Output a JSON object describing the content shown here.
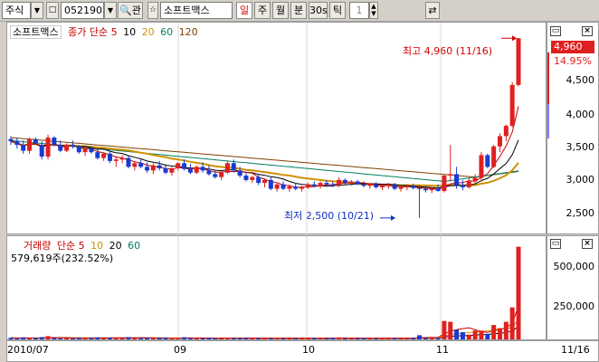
{
  "toolbar": {
    "market": "주식",
    "code": "052190",
    "search_label": "관",
    "name": "소프트맥스",
    "periods": [
      "일",
      "주",
      "월",
      "분",
      "30s",
      "틱"
    ],
    "active_period": "일",
    "interval": "1"
  },
  "price_panel": {
    "legend_name": "소프트맥스",
    "legend_items": [
      {
        "label": "종가 단순 5",
        "color": "#c00000"
      },
      {
        "label": "10",
        "color": "#000000"
      },
      {
        "label": "20",
        "color": "#d09000"
      },
      {
        "label": "60",
        "color": "#008060"
      },
      {
        "label": "120",
        "color": "#804000"
      }
    ],
    "high_note": "최고 4,960 (11/16)",
    "low_note": "최저 2,500 (10/21)",
    "last_price": "4,960",
    "change_pct": "14.95%",
    "y_ticks": [
      "4,500",
      "4,000",
      "3,500",
      "3,000",
      "2,500"
    ]
  },
  "volume_panel": {
    "legend_items": [
      {
        "label": "거래량",
        "color": "#c00000"
      },
      {
        "label": "단순 5",
        "color": "#c00000"
      },
      {
        "label": "10",
        "color": "#d09000"
      },
      {
        "label": "20",
        "color": "#000000"
      },
      {
        "label": "60",
        "color": "#008060"
      }
    ],
    "volume_text": "579,619주(232.52%)",
    "y_ticks": [
      "500,000",
      "250,000"
    ]
  },
  "x_axis": {
    "labels": [
      "2010/07",
      "09",
      "10",
      "11",
      "11/16"
    ]
  },
  "colors": {
    "up": "#e02020",
    "down": "#1a3ad0",
    "background": "#ffffff",
    "frame": "#d4d0c8"
  },
  "chart_data": {
    "type": "candlestick",
    "period_from": "2010/07",
    "period_to": "11/16",
    "candles": [
      [
        3580,
        3620,
        3500,
        3550
      ],
      [
        3550,
        3600,
        3450,
        3500
      ],
      [
        3500,
        3560,
        3380,
        3420
      ],
      [
        3420,
        3600,
        3380,
        3580
      ],
      [
        3580,
        3600,
        3500,
        3520
      ],
      [
        3500,
        3550,
        3300,
        3340
      ],
      [
        3340,
        3640,
        3300,
        3600
      ],
      [
        3600,
        3620,
        3480,
        3500
      ],
      [
        3500,
        3560,
        3400,
        3420
      ],
      [
        3420,
        3520,
        3400,
        3500
      ],
      [
        3500,
        3560,
        3450,
        3480
      ],
      [
        3480,
        3500,
        3380,
        3400
      ],
      [
        3400,
        3480,
        3350,
        3450
      ],
      [
        3450,
        3480,
        3380,
        3400
      ],
      [
        3400,
        3450,
        3300,
        3320
      ],
      [
        3320,
        3400,
        3280,
        3380
      ],
      [
        3380,
        3420,
        3250,
        3280
      ],
      [
        3280,
        3340,
        3200,
        3300
      ],
      [
        3300,
        3360,
        3250,
        3320
      ],
      [
        3320,
        3350,
        3180,
        3200
      ],
      [
        3200,
        3280,
        3150,
        3250
      ],
      [
        3250,
        3300,
        3180,
        3200
      ],
      [
        3200,
        3260,
        3120,
        3150
      ],
      [
        3150,
        3250,
        3100,
        3220
      ],
      [
        3220,
        3280,
        3150,
        3180
      ],
      [
        3180,
        3240,
        3100,
        3120
      ],
      [
        3120,
        3200,
        3080,
        3180
      ],
      [
        3180,
        3260,
        3150,
        3250
      ],
      [
        3250,
        3300,
        3150,
        3170
      ],
      [
        3170,
        3240,
        3100,
        3120
      ],
      [
        3120,
        3220,
        3100,
        3200
      ],
      [
        3200,
        3260,
        3120,
        3150
      ],
      [
        3150,
        3220,
        3080,
        3100
      ],
      [
        3100,
        3160,
        3040,
        3060
      ],
      [
        3060,
        3140,
        3020,
        3120
      ],
      [
        3120,
        3280,
        3100,
        3250
      ],
      [
        3250,
        3300,
        3120,
        3150
      ],
      [
        3150,
        3200,
        3050,
        3080
      ],
      [
        3080,
        3130,
        3000,
        3020
      ],
      [
        3020,
        3080,
        2980,
        3060
      ],
      [
        3060,
        3100,
        2950,
        2980
      ],
      [
        2980,
        3040,
        2920,
        3020
      ],
      [
        3020,
        3060,
        2880,
        2900
      ],
      [
        2900,
        2980,
        2860,
        2960
      ],
      [
        2960,
        3000,
        2880,
        2900
      ],
      [
        2900,
        2960,
        2860,
        2930
      ],
      [
        2930,
        2980,
        2880,
        2900
      ],
      [
        2900,
        2940,
        2860,
        2920
      ],
      [
        2920,
        2980,
        2900,
        2960
      ],
      [
        2960,
        3000,
        2920,
        2940
      ],
      [
        2940,
        3000,
        2900,
        2980
      ],
      [
        2980,
        3020,
        2940,
        2960
      ],
      [
        2960,
        3000,
        2920,
        2950
      ],
      [
        2950,
        3060,
        2920,
        3020
      ],
      [
        3020,
        3040,
        2960,
        2980
      ],
      [
        2980,
        3020,
        2940,
        3000
      ],
      [
        3000,
        3020,
        2950,
        2960
      ],
      [
        2960,
        3000,
        2920,
        2940
      ],
      [
        2940,
        2980,
        2900,
        2960
      ],
      [
        2960,
        2990,
        2900,
        2920
      ],
      [
        2920,
        2960,
        2880,
        2940
      ],
      [
        2940,
        2980,
        2900,
        2950
      ],
      [
        2950,
        2980,
        2880,
        2900
      ],
      [
        2900,
        2940,
        2860,
        2920
      ],
      [
        2920,
        2960,
        2880,
        2940
      ],
      [
        2940,
        2970,
        2890,
        2910
      ],
      [
        2910,
        2950,
        2500,
        2900
      ],
      [
        2900,
        2940,
        2850,
        2880
      ],
      [
        2880,
        2920,
        2840,
        2900
      ],
      [
        2900,
        2960,
        2860,
        2870
      ],
      [
        2870,
        3100,
        2850,
        3080
      ],
      [
        3080,
        3500,
        3000,
        3100
      ],
      [
        3100,
        3200,
        2900,
        2950
      ],
      [
        2950,
        3020,
        2880,
        2920
      ],
      [
        2920,
        3050,
        2900,
        3000
      ],
      [
        3000,
        3100,
        2960,
        3050
      ],
      [
        3050,
        3400,
        3000,
        3360
      ],
      [
        3360,
        3380,
        3180,
        3200
      ],
      [
        3200,
        3500,
        3180,
        3480
      ],
      [
        3480,
        3660,
        3400,
        3620
      ],
      [
        3620,
        3780,
        3550,
        3760
      ],
      [
        3760,
        4360,
        3740,
        4320
      ],
      [
        4320,
        4960,
        4300,
        4960
      ]
    ],
    "volumes": [
      10000,
      6000,
      12000,
      5000,
      9000,
      14000,
      20000,
      8000,
      6000,
      7000,
      5000,
      9000,
      6000,
      8000,
      12000,
      7000,
      9000,
      11000,
      6000,
      14000,
      10000,
      7000,
      9000,
      5000,
      8000,
      10000,
      6000,
      9000,
      13000,
      7000,
      8000,
      6000,
      9000,
      7000,
      6000,
      11000,
      8000,
      7000,
      9000,
      6000,
      7000,
      10000,
      6000,
      8000,
      5000,
      7000,
      6000,
      9000,
      5000,
      8000,
      10000,
      6000,
      9000,
      12000,
      5000,
      7000,
      6000,
      8000,
      7000,
      5000,
      9000,
      6000,
      8000,
      7000,
      6000,
      8000,
      26000,
      9000,
      11000,
      8000,
      115000,
      110000,
      60000,
      45000,
      30000,
      55000,
      55000,
      35000,
      90000,
      70000,
      110000,
      200000,
      579619
    ],
    "y_range_price": [
      2300,
      5000
    ],
    "y_range_volume": [
      0,
      600000
    ]
  }
}
